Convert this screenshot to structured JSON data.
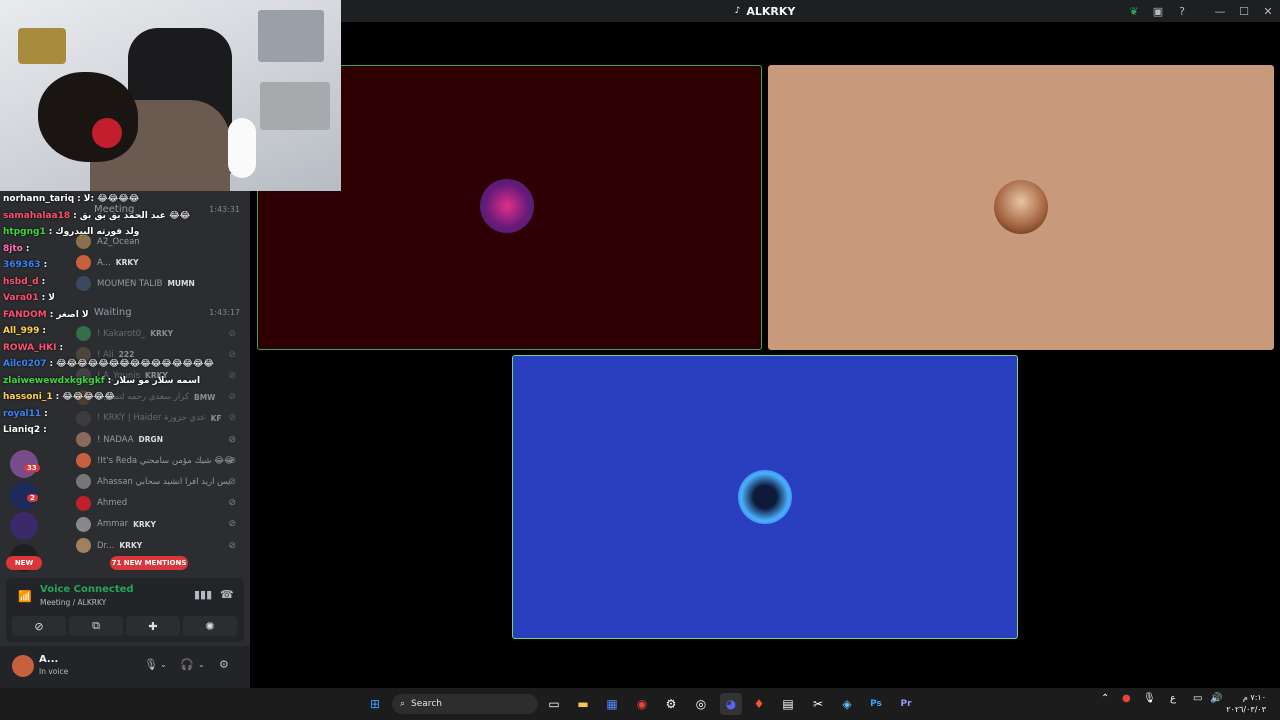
{
  "window": {
    "title": "ALKRKY"
  },
  "chat": {
    "lines": [
      {
        "user": "norhann_tariq",
        "color": "#ffffff",
        "msg": "لا: 😂😂😂😂"
      },
      {
        "user": "samahalaa18",
        "color": "#ff4f6e",
        "msg": "عبد الحمد بق بق بق 😂😂"
      },
      {
        "user": "htpgng1",
        "color": "#3dd63d",
        "msg": "ولد فورته البيدروك"
      },
      {
        "user": "8jto",
        "color": "#ff6fb5",
        "msg": ""
      },
      {
        "user": "369363",
        "color": "#3b82f6",
        "msg": ""
      },
      {
        "user": "hsbd_d",
        "color": "#ff4f6e",
        "msg": ""
      },
      {
        "user": "Vara01",
        "color": "#ff4f6e",
        "msg": "لا"
      },
      {
        "user": "FANDOM",
        "color": "#ff4f6e",
        "msg": "لا اصغر"
      },
      {
        "user": "All_999",
        "color": "#ffd34d",
        "msg": ""
      },
      {
        "user": "ROWA_HKI",
        "color": "#ff4f6e",
        "msg": ""
      },
      {
        "user": "Ailc0207",
        "color": "#3b82f6",
        "msg": "😂😂😂😂😂😂😂😂😂😂😂😂😂😂😂"
      },
      {
        "user": "zlaiwewewdxkgkgkf",
        "color": "#3dd63d",
        "msg": "اسمه سلار مو سلار"
      },
      {
        "user": "hassoni_1",
        "color": "#ffd34d",
        "msg": "😂😂😂😂😂"
      },
      {
        "user": "royal11",
        "color": "#3b82f6",
        "msg": ""
      },
      {
        "user": "Lianiq2",
        "color": "#ffffff",
        "msg": ""
      }
    ]
  },
  "rail": {
    "badges": [
      "33",
      "2"
    ],
    "new_label": "NEW"
  },
  "channels": {
    "meeting": {
      "name": "Meeting",
      "time": "1:43:31"
    },
    "waiting": {
      "name": "Waiting",
      "time": "1:43:17"
    },
    "meeting_members": [
      {
        "name": "A2_Ocean",
        "tag": "",
        "color": "#8b6f4e"
      },
      {
        "name": "A...",
        "tag": "KRKY",
        "color": "#c7603d"
      },
      {
        "name": "MOUMEN TALIB",
        "tag": "MUMN",
        "color": "#3a4a5c"
      }
    ],
    "waiting_members": [
      {
        "name": "! Kakarot0_",
        "tag": "KRKY",
        "color": "#3ba55c",
        "dim": true
      },
      {
        "name": "! Ali",
        "tag": "222",
        "color": "#6b5a4a",
        "dim": true
      },
      {
        "name": "! A_Younis",
        "tag": "KRKY",
        "color": "#555",
        "dim": true
      },
      {
        "name": "! كرار سعدي رحمه لتمثال",
        "tag": "BMW",
        "color": "#6b4a3a",
        "dim": true
      },
      {
        "name": "! KRKY | Haider عدي جزوزة",
        "tag": "KF",
        "color": "#4a4a4a",
        "dim": true
      },
      {
        "name": "! NADAA",
        "tag": "DRGN",
        "color": "#8a6a5a",
        "dim": false
      },
      {
        "name": "!It's Reda شيك مؤمن سامحني 😂😂",
        "tag": "",
        "color": "#c7603d",
        "dim": false
      },
      {
        "name": "Ahassan يس اريد افرا انشيد سحابي",
        "tag": "",
        "color": "#777",
        "dim": false
      },
      {
        "name": "Ahmed",
        "tag": "",
        "color": "#c11f2c",
        "dim": false
      },
      {
        "name": "Ammar",
        "tag": "KRKY",
        "color": "#888",
        "dim": false
      },
      {
        "name": "Dr...",
        "tag": "KRKY",
        "color": "#a08060",
        "dim": false
      }
    ],
    "mentions_label": "71 NEW MENTIONS"
  },
  "voice": {
    "status": "Voice Connected",
    "channel": "Meeting / ALKRKY"
  },
  "user": {
    "name": "A...",
    "status": "In voice"
  },
  "taskbar": {
    "search_label": "Search",
    "clock_time": "٧:١٠ م",
    "clock_date": "٢٠٢٦/٠٣/٠٣",
    "lang": "ع"
  },
  "colors": {
    "tile1_bg": "#2e0004",
    "tile2_bg": "#c8997a",
    "tile3_bg": "#2a3fbf",
    "speaking_border": "#3ba55c",
    "voice_green": "#23a55a"
  }
}
